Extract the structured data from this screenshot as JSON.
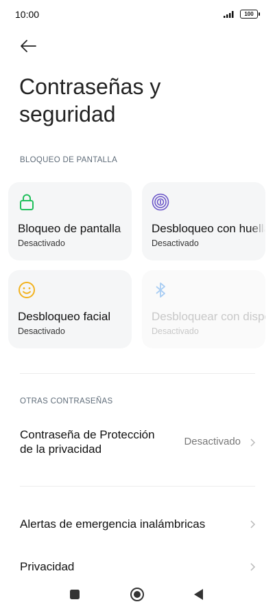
{
  "status_bar": {
    "time": "10:00",
    "battery": "100"
  },
  "page": {
    "title": "Contraseñas y seguridad"
  },
  "screen_lock": {
    "header": "BLOQUEO DE PANTALLA",
    "cards": [
      {
        "label": "Bloqueo de pantalla",
        "status": "Desactivado",
        "icon": "lock-icon",
        "color": "#1fbf5a"
      },
      {
        "label": "Desbloqueo con huella",
        "status": "Desactivado",
        "icon": "fingerprint-icon",
        "color": "#6a55c8"
      },
      {
        "label": "Desbloqueo facial",
        "status": "Desactivado",
        "icon": "face-icon",
        "color": "#f2b21e"
      },
      {
        "label": "Desbloquear con dispositivo Bluetooth",
        "status": "Desactivado",
        "icon": "bluetooth-icon",
        "color": "#a9cdf3"
      }
    ]
  },
  "other_passwords": {
    "header": "OTRAS CONTRASEÑAS",
    "privacy_password": {
      "label": "Contraseña de Protección de la privacidad",
      "value": "Desactivado"
    }
  },
  "menu": {
    "emergency_alerts": "Alertas de emergencia inalámbricas",
    "privacy": "Privacidad"
  }
}
